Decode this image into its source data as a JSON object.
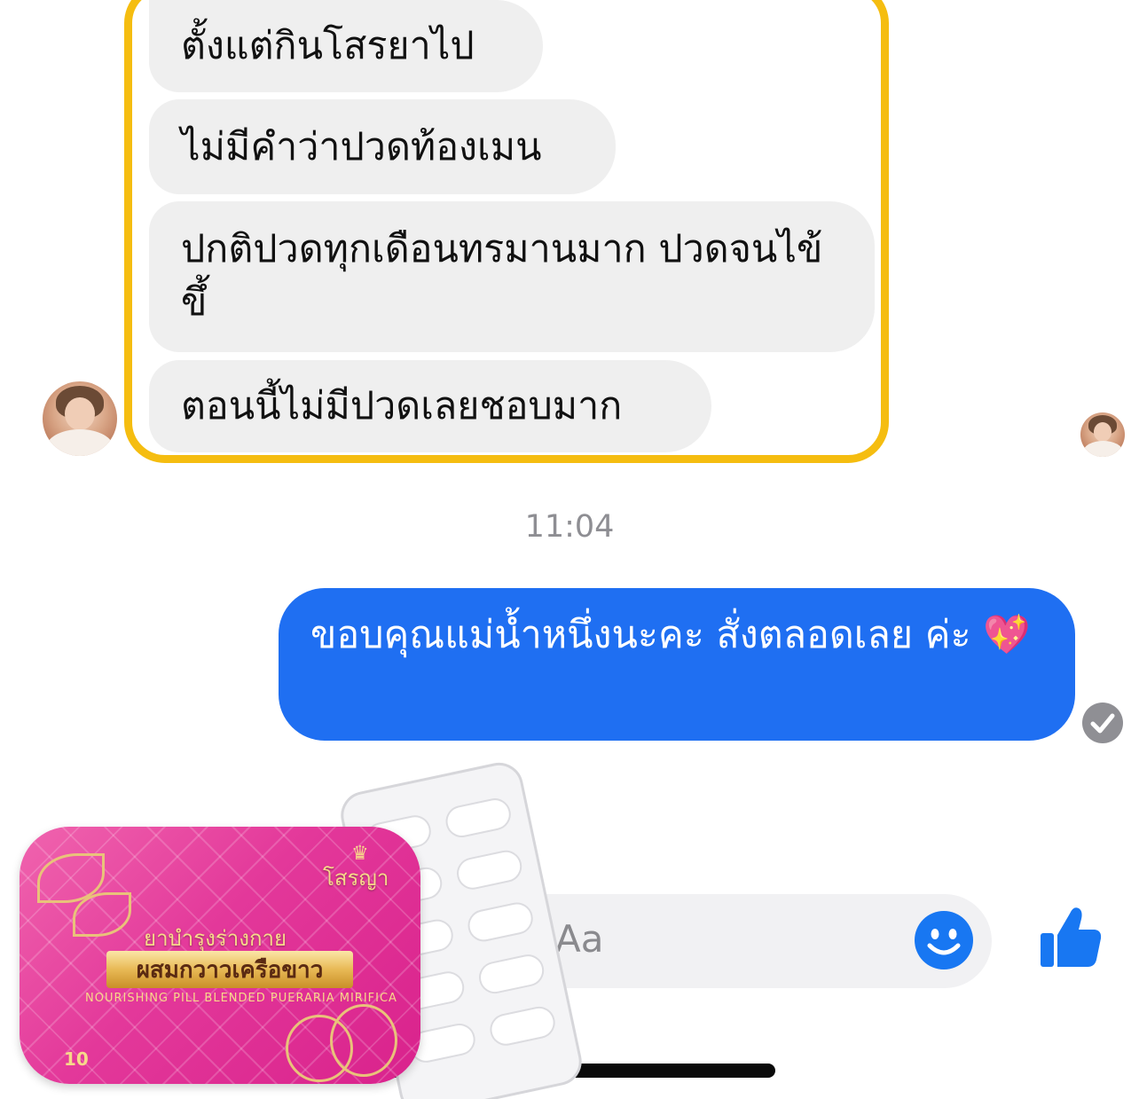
{
  "conversation": {
    "incoming": [
      "ตั้งแต่กินโสรยาไป",
      "ไม่มีคำว่าปวดท้องเมน",
      "ปกติปวดทุกเดือนทรมานมาก ปวดจนไข้ขึ้",
      "ตอนนี้ไม่มีปวดเลยชอบมาก"
    ],
    "timestamp": "11:04",
    "outgoing": "ขอบคุณแม่น้ำหนึ่งนะคะ สั่งตลอดเลย ค่ะ 💖"
  },
  "composer": {
    "placeholder_fragment": "Aa"
  },
  "icons": {
    "seen": "check-circle-icon",
    "emoji": "smiley-icon",
    "like": "thumbs-up-icon"
  },
  "product": {
    "brand": "โสรญา",
    "crown": "♛",
    "title": "ยาบำรุงร่างกาย",
    "label": "ผสมกวาวเครือขาว",
    "subtitle": "NOURISHING PILL BLENDED PUERARIA MIRIFICA",
    "quantity": "10"
  },
  "colors": {
    "highlight_border": "#f5bd10",
    "incoming_bubble": "#efefef",
    "outgoing_bubble": "#1f6ff2",
    "accent_blue": "#1877f2",
    "product_pink": "#e3389a",
    "product_gold": "#e8b955"
  }
}
